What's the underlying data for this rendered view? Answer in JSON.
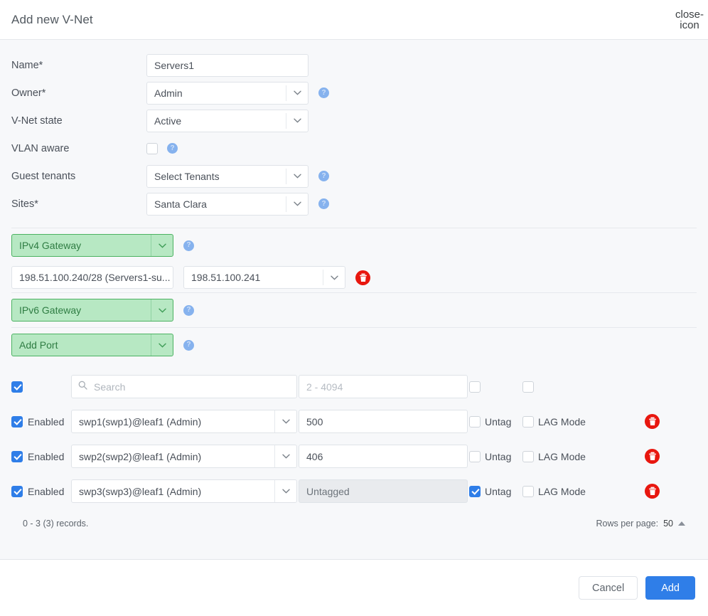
{
  "dialog": {
    "title": "Add new V-Net",
    "close_icon": "close-icon"
  },
  "form": {
    "name": {
      "label": "Name*",
      "value": "Servers1"
    },
    "owner": {
      "label": "Owner*",
      "value": "Admin",
      "help": "?"
    },
    "vnet_state": {
      "label": "V-Net state",
      "value": "Active"
    },
    "vlan_aware": {
      "label": "VLAN aware",
      "checked": false,
      "help": "?"
    },
    "guest_tenants": {
      "label": "Guest tenants",
      "value": "Select Tenants",
      "help": "?"
    },
    "sites": {
      "label": "Sites*",
      "value": "Santa Clara",
      "help": "?"
    }
  },
  "ipv4_gateway": {
    "button_label": "IPv4 Gateway",
    "help": "?",
    "subnet": "198.51.100.240/28 (Servers1-su...",
    "ip": "198.51.100.241",
    "delete_icon": "trash-icon"
  },
  "ipv6_gateway": {
    "button_label": "IPv6 Gateway",
    "help": "?"
  },
  "add_port": {
    "button_label": "Add Port",
    "help": "?"
  },
  "ports_table": {
    "header": {
      "select_all_checked": true,
      "search_placeholder": "Search",
      "search_value": "",
      "search_icon": "search-icon",
      "vlan_placeholder": "2 - 4094",
      "vlan_value": "",
      "untag_checked": false,
      "lag_checked": false
    },
    "rows": [
      {
        "enabled_checked": true,
        "enabled_label": "Enabled",
        "port": "swp1(swp1)@leaf1 (Admin)",
        "vlan": "500",
        "vlan_disabled": false,
        "untag_checked": false,
        "untag_label": "Untag",
        "lag_checked": false,
        "lag_label": "LAG Mode",
        "delete_icon": "trash-icon"
      },
      {
        "enabled_checked": true,
        "enabled_label": "Enabled",
        "port": "swp2(swp2)@leaf1 (Admin)",
        "vlan": "406",
        "vlan_disabled": false,
        "untag_checked": false,
        "untag_label": "Untag",
        "lag_checked": false,
        "lag_label": "LAG Mode",
        "delete_icon": "trash-icon"
      },
      {
        "enabled_checked": true,
        "enabled_label": "Enabled",
        "port": "swp3(swp3)@leaf1 (Admin)",
        "vlan": "Untagged",
        "vlan_disabled": true,
        "untag_checked": true,
        "untag_label": "Untag",
        "lag_checked": false,
        "lag_label": "LAG Mode",
        "delete_icon": "trash-icon"
      }
    ],
    "records_text": "0 - 3 (3) records.",
    "rows_per_page_label": "Rows per page:",
    "rows_per_page_value": "50"
  },
  "footer": {
    "cancel_label": "Cancel",
    "add_label": "Add"
  },
  "colors": {
    "primary": "#2f7ee8",
    "green_fill": "#b7e8c3",
    "green_border": "#4cb262",
    "green_text": "#2f7d43",
    "danger": "#e8170f",
    "body_bg": "#f7f8fa"
  }
}
